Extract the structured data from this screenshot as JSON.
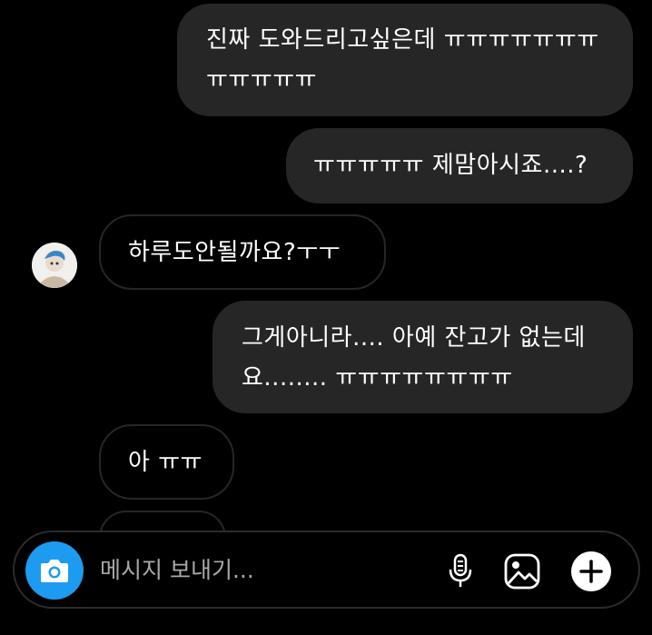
{
  "messages": [
    {
      "id": "m1",
      "side": "outgoing",
      "text": "진짜 도와드리고싶은데 ㅠㅠㅠㅠㅠㅠㅠ\nㅠㅠㅠㅠㅠ"
    },
    {
      "id": "m2",
      "side": "outgoing",
      "text": "ㅠㅠㅠㅠㅠ 제맘아시죠....?"
    },
    {
      "id": "m3",
      "side": "incoming",
      "text": "하루도안될까요?ㅜㅜ"
    },
    {
      "id": "m4",
      "side": "outgoing",
      "text": "그게아니라.... 아예 잔고가 없는데\n요........ ㅠㅠㅠㅠㅠㅠㅠㅠ"
    },
    {
      "id": "m5",
      "side": "incoming",
      "text": "아 ㅠㅠ"
    }
  ],
  "composer": {
    "placeholder": "메시지 보내기...",
    "camera_icon": "camera-icon",
    "mic_icon": "microphone-icon",
    "gallery_icon": "image-gallery-icon",
    "plus_icon": "plus-icon",
    "accent": "#1d9bf0"
  },
  "colors": {
    "background": "#000000",
    "outgoing_bubble": "#262626",
    "incoming_border": "#262626"
  }
}
